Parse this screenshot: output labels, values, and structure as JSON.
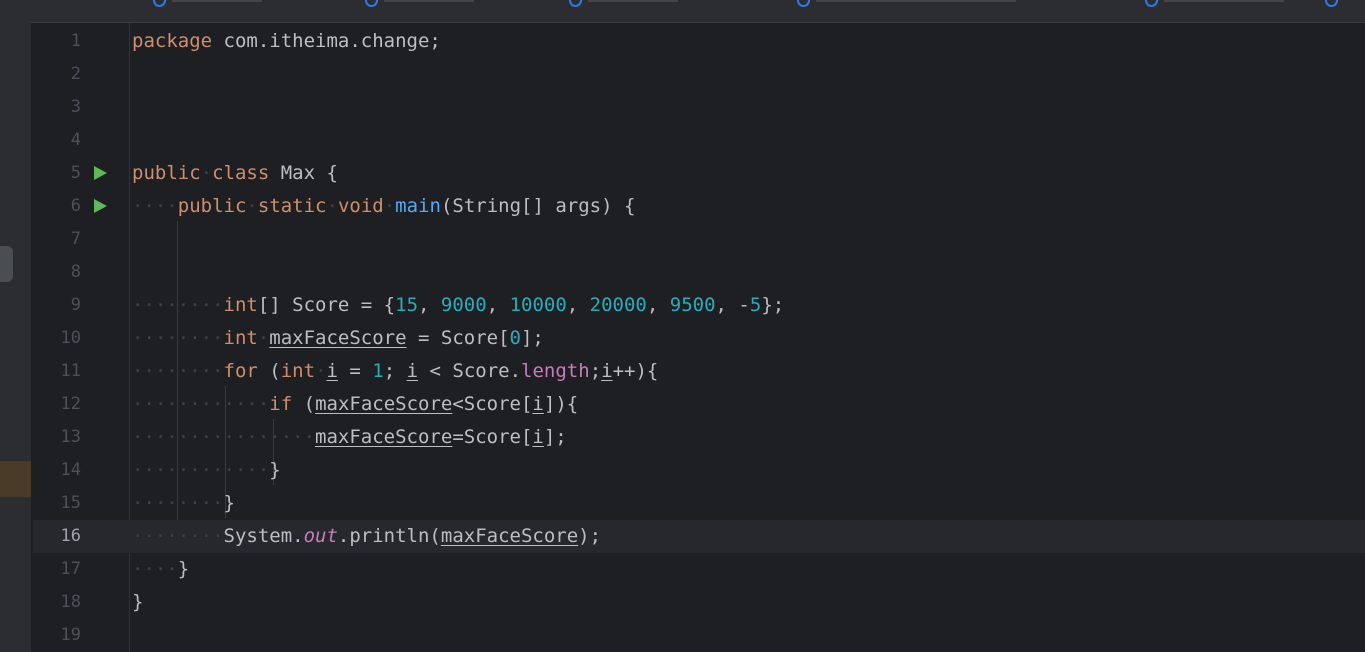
{
  "colors": {
    "background": "#1e1f22",
    "keyword": "#cf8e6d",
    "method": "#56a8f5",
    "number": "#2aacb8",
    "field": "#c77dbb",
    "text": "#bcbec4",
    "line_number": "#4b5059",
    "run_icon": "#5fb85a"
  },
  "editor": {
    "current_line": 16,
    "lines": [
      {
        "num": "1"
      },
      {
        "num": "2"
      },
      {
        "num": "3"
      },
      {
        "num": "4"
      },
      {
        "num": "5"
      },
      {
        "num": "6"
      },
      {
        "num": "7"
      },
      {
        "num": "8"
      },
      {
        "num": "9"
      },
      {
        "num": "10"
      },
      {
        "num": "11"
      },
      {
        "num": "12"
      },
      {
        "num": "13"
      },
      {
        "num": "14"
      },
      {
        "num": "15"
      },
      {
        "num": "16"
      },
      {
        "num": "17"
      },
      {
        "num": "18"
      },
      {
        "num": "19"
      }
    ],
    "code": {
      "l1": {
        "kw": "package",
        "rest": " com.itheima.change;"
      },
      "l5": {
        "kw1": "public",
        "kw2": "class",
        "rest": " Max {"
      },
      "l6": {
        "kw1": "public",
        "kw2": "static",
        "kw3": "void",
        "method": "main",
        "rest": "(String[] args) {"
      },
      "l9": {
        "kw": "int",
        "a": "[] Score = {",
        "n1": "15",
        "n2": "9000",
        "n3": "10000",
        "n4": "20000",
        "n5": "9500",
        "neg": "-",
        "n6": "5",
        "end": "};"
      },
      "l10": {
        "kw": "int",
        "var": "maxFaceScore",
        "a": " = Score[",
        "n": "0",
        "end": "];"
      },
      "l11": {
        "kw": "for",
        "a": " (",
        "kw2": "int",
        "i1": "i",
        "b": " = ",
        "n": "1",
        "c": "; ",
        "i2": "i",
        "d": " < Score.",
        "field": "length",
        "e": ";",
        "i3": "i",
        "end": "++){"
      },
      "l12": {
        "kw": "if",
        "a": " (",
        "var": "maxFaceScore",
        "b": "<Score[",
        "i": "i",
        "end": "]){"
      },
      "l13": {
        "var": "maxFaceScore",
        "a": "=Score[",
        "i": "i",
        "end": "];"
      },
      "l14": {
        "text": "}"
      },
      "l15": {
        "text": "}"
      },
      "l16": {
        "a": "System.",
        "static": "out",
        "b": ".println(",
        "var": "maxFaceScore",
        "end": ");"
      },
      "l17": {
        "text": "}"
      },
      "l18": {
        "text": "}"
      }
    }
  }
}
